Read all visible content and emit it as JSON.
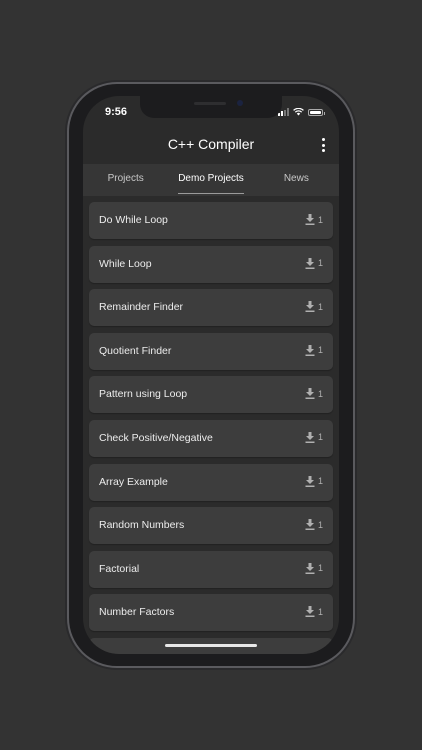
{
  "status": {
    "time": "9:56"
  },
  "appbar": {
    "title": "C++ Compiler",
    "menu_icon": "more-vert-icon"
  },
  "tabs": [
    {
      "label": "Projects",
      "active": false
    },
    {
      "label": "Demo Projects",
      "active": true
    },
    {
      "label": "News",
      "active": false
    }
  ],
  "projects": [
    {
      "name": "Do While Loop",
      "downloads": "1"
    },
    {
      "name": "While Loop",
      "downloads": "1"
    },
    {
      "name": "Remainder Finder",
      "downloads": "1"
    },
    {
      "name": "Quotient Finder",
      "downloads": "1"
    },
    {
      "name": "Pattern using Loop",
      "downloads": "1"
    },
    {
      "name": "Check Positive/Negative",
      "downloads": "1"
    },
    {
      "name": "Array Example",
      "downloads": "1"
    },
    {
      "name": "Random Numbers",
      "downloads": "1"
    },
    {
      "name": "Factorial",
      "downloads": "1"
    },
    {
      "name": "Number Factors",
      "downloads": "1"
    },
    {
      "name": "",
      "downloads": ""
    }
  ],
  "colors": {
    "background": "#333333",
    "screen": "#2b2b2b",
    "card": "#3d3d3d",
    "tabbar": "#363636"
  }
}
